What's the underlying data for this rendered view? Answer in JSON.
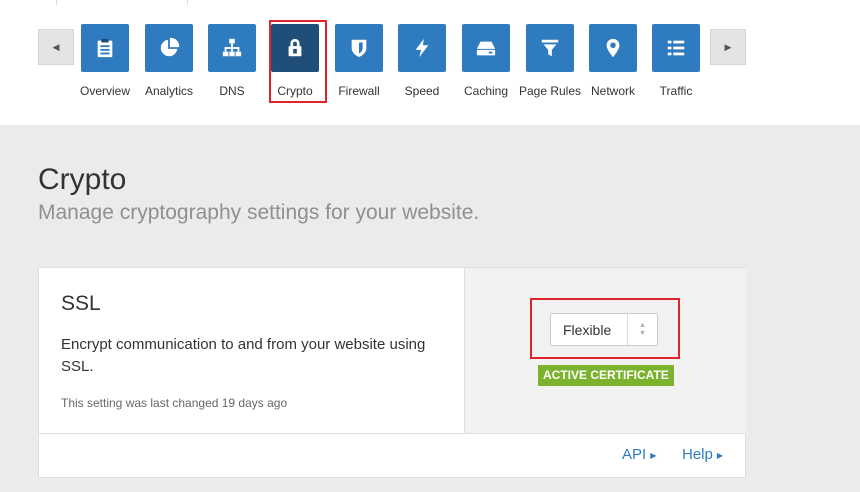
{
  "nav": {
    "scroll_left_glyph": "◀",
    "scroll_right_glyph": "▶",
    "items": [
      {
        "label": "Overview",
        "icon": "clipboard-icon"
      },
      {
        "label": "Analytics",
        "icon": "pie-chart-icon"
      },
      {
        "label": "DNS",
        "icon": "sitemap-icon"
      },
      {
        "label": "Crypto",
        "icon": "lock-icon"
      },
      {
        "label": "Firewall",
        "icon": "shield-icon"
      },
      {
        "label": "Speed",
        "icon": "lightning-icon"
      },
      {
        "label": "Caching",
        "icon": "hard-drive-icon"
      },
      {
        "label": "Page Rules",
        "icon": "filter-icon"
      },
      {
        "label": "Network",
        "icon": "map-pin-icon"
      },
      {
        "label": "Traffic",
        "icon": "list-icon"
      }
    ],
    "active": "Crypto",
    "colors": {
      "tile": "#2f7bbf",
      "active_tile": "#1f4e79"
    }
  },
  "page": {
    "title": "Crypto",
    "subtitle": "Manage cryptography settings for your website."
  },
  "ssl": {
    "title": "SSL",
    "description": "Encrypt communication to and from your website using SSL.",
    "note": "This setting was last changed 19 days ago",
    "select_value": "Flexible",
    "badge": "ACTIVE CERTIFICATE",
    "badge_color": "#7cb32e",
    "footer_links": {
      "api": "API",
      "help": "Help"
    }
  },
  "highlight_color": "#e0242b"
}
